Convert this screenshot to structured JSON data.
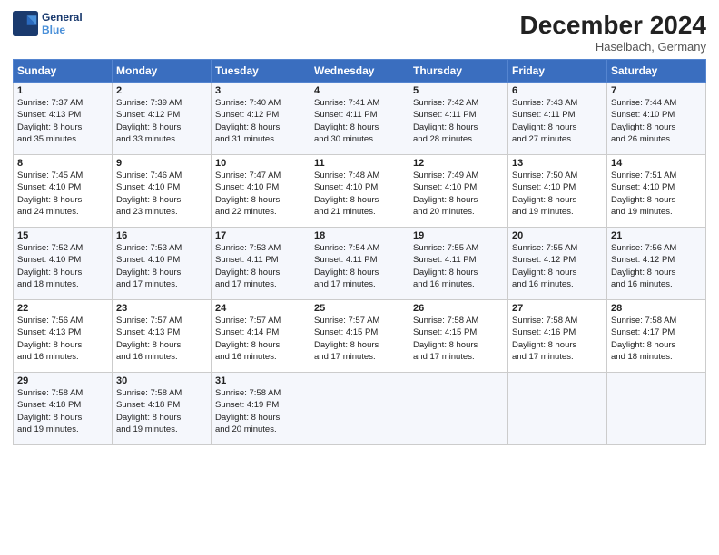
{
  "header": {
    "logo_line1": "General",
    "logo_line2": "Blue",
    "month": "December 2024",
    "location": "Haselbach, Germany"
  },
  "days_of_week": [
    "Sunday",
    "Monday",
    "Tuesday",
    "Wednesday",
    "Thursday",
    "Friday",
    "Saturday"
  ],
  "weeks": [
    [
      {
        "day": "1",
        "info": "Sunrise: 7:37 AM\nSunset: 4:13 PM\nDaylight: 8 hours\nand 35 minutes."
      },
      {
        "day": "2",
        "info": "Sunrise: 7:39 AM\nSunset: 4:12 PM\nDaylight: 8 hours\nand 33 minutes."
      },
      {
        "day": "3",
        "info": "Sunrise: 7:40 AM\nSunset: 4:12 PM\nDaylight: 8 hours\nand 31 minutes."
      },
      {
        "day": "4",
        "info": "Sunrise: 7:41 AM\nSunset: 4:11 PM\nDaylight: 8 hours\nand 30 minutes."
      },
      {
        "day": "5",
        "info": "Sunrise: 7:42 AM\nSunset: 4:11 PM\nDaylight: 8 hours\nand 28 minutes."
      },
      {
        "day": "6",
        "info": "Sunrise: 7:43 AM\nSunset: 4:11 PM\nDaylight: 8 hours\nand 27 minutes."
      },
      {
        "day": "7",
        "info": "Sunrise: 7:44 AM\nSunset: 4:10 PM\nDaylight: 8 hours\nand 26 minutes."
      }
    ],
    [
      {
        "day": "8",
        "info": "Sunrise: 7:45 AM\nSunset: 4:10 PM\nDaylight: 8 hours\nand 24 minutes."
      },
      {
        "day": "9",
        "info": "Sunrise: 7:46 AM\nSunset: 4:10 PM\nDaylight: 8 hours\nand 23 minutes."
      },
      {
        "day": "10",
        "info": "Sunrise: 7:47 AM\nSunset: 4:10 PM\nDaylight: 8 hours\nand 22 minutes."
      },
      {
        "day": "11",
        "info": "Sunrise: 7:48 AM\nSunset: 4:10 PM\nDaylight: 8 hours\nand 21 minutes."
      },
      {
        "day": "12",
        "info": "Sunrise: 7:49 AM\nSunset: 4:10 PM\nDaylight: 8 hours\nand 20 minutes."
      },
      {
        "day": "13",
        "info": "Sunrise: 7:50 AM\nSunset: 4:10 PM\nDaylight: 8 hours\nand 19 minutes."
      },
      {
        "day": "14",
        "info": "Sunrise: 7:51 AM\nSunset: 4:10 PM\nDaylight: 8 hours\nand 19 minutes."
      }
    ],
    [
      {
        "day": "15",
        "info": "Sunrise: 7:52 AM\nSunset: 4:10 PM\nDaylight: 8 hours\nand 18 minutes."
      },
      {
        "day": "16",
        "info": "Sunrise: 7:53 AM\nSunset: 4:10 PM\nDaylight: 8 hours\nand 17 minutes."
      },
      {
        "day": "17",
        "info": "Sunrise: 7:53 AM\nSunset: 4:11 PM\nDaylight: 8 hours\nand 17 minutes."
      },
      {
        "day": "18",
        "info": "Sunrise: 7:54 AM\nSunset: 4:11 PM\nDaylight: 8 hours\nand 17 minutes."
      },
      {
        "day": "19",
        "info": "Sunrise: 7:55 AM\nSunset: 4:11 PM\nDaylight: 8 hours\nand 16 minutes."
      },
      {
        "day": "20",
        "info": "Sunrise: 7:55 AM\nSunset: 4:12 PM\nDaylight: 8 hours\nand 16 minutes."
      },
      {
        "day": "21",
        "info": "Sunrise: 7:56 AM\nSunset: 4:12 PM\nDaylight: 8 hours\nand 16 minutes."
      }
    ],
    [
      {
        "day": "22",
        "info": "Sunrise: 7:56 AM\nSunset: 4:13 PM\nDaylight: 8 hours\nand 16 minutes."
      },
      {
        "day": "23",
        "info": "Sunrise: 7:57 AM\nSunset: 4:13 PM\nDaylight: 8 hours\nand 16 minutes."
      },
      {
        "day": "24",
        "info": "Sunrise: 7:57 AM\nSunset: 4:14 PM\nDaylight: 8 hours\nand 16 minutes."
      },
      {
        "day": "25",
        "info": "Sunrise: 7:57 AM\nSunset: 4:15 PM\nDaylight: 8 hours\nand 17 minutes."
      },
      {
        "day": "26",
        "info": "Sunrise: 7:58 AM\nSunset: 4:15 PM\nDaylight: 8 hours\nand 17 minutes."
      },
      {
        "day": "27",
        "info": "Sunrise: 7:58 AM\nSunset: 4:16 PM\nDaylight: 8 hours\nand 17 minutes."
      },
      {
        "day": "28",
        "info": "Sunrise: 7:58 AM\nSunset: 4:17 PM\nDaylight: 8 hours\nand 18 minutes."
      }
    ],
    [
      {
        "day": "29",
        "info": "Sunrise: 7:58 AM\nSunset: 4:18 PM\nDaylight: 8 hours\nand 19 minutes."
      },
      {
        "day": "30",
        "info": "Sunrise: 7:58 AM\nSunset: 4:18 PM\nDaylight: 8 hours\nand 19 minutes."
      },
      {
        "day": "31",
        "info": "Sunrise: 7:58 AM\nSunset: 4:19 PM\nDaylight: 8 hours\nand 20 minutes."
      },
      {
        "day": "",
        "info": ""
      },
      {
        "day": "",
        "info": ""
      },
      {
        "day": "",
        "info": ""
      },
      {
        "day": "",
        "info": ""
      }
    ]
  ]
}
